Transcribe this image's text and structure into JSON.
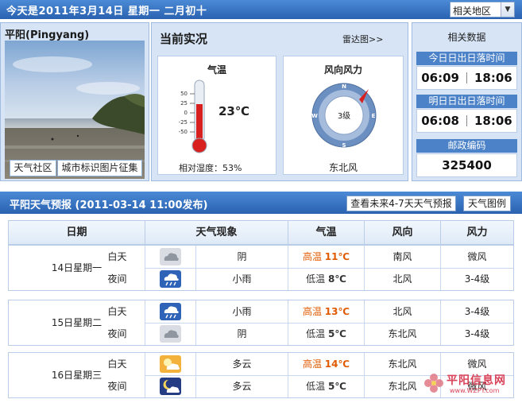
{
  "topbar": {
    "date": "今天是2011年3月14日 星期一 二月初十",
    "region": "相关地区"
  },
  "city": {
    "name": "平阳(Pingyang)",
    "btn_community": "天气社区",
    "btn_photo": "城市标识图片征集"
  },
  "current": {
    "title": "当前实况",
    "radar": "雷达图>>",
    "temp": {
      "title": "气温",
      "value": "23℃",
      "value_num": 23,
      "scale": [
        "50",
        "25",
        "0",
        "-25",
        "-50"
      ],
      "humidity": "相对湿度：53%"
    },
    "wind": {
      "title": "风向风力",
      "level": "3级",
      "dir": "东北风",
      "compass": [
        "N",
        "E",
        "S",
        "W"
      ]
    }
  },
  "data": {
    "title": "相关数据",
    "today_label": "今日日出日落时间",
    "today_rise": "06:09",
    "today_set": "18:06",
    "tomorrow_label": "明日日出日落时间",
    "tomorrow_rise": "06:08",
    "tomorrow_set": "18:06",
    "post_label": "邮政编码",
    "post_code": "325400"
  },
  "forecast": {
    "title": "平阳天气预报 (2011-03-14  11:00发布)",
    "btn_future": "查看未来4-7天天气预报",
    "btn_legend": "天气图例",
    "headers": [
      "日期",
      "天气现象",
      "气温",
      "风向",
      "风力"
    ],
    "days": [
      {
        "date": "14日星期一",
        "day": {
          "label": "白天",
          "weather": "阴",
          "icon": "overcast-icon",
          "tlabel": "高温",
          "temp": "11℃",
          "wind": "南风",
          "force": "微风"
        },
        "night": {
          "label": "夜间",
          "weather": "小雨",
          "icon": "rain-icon",
          "tlabel": "低温",
          "temp": "8℃",
          "wind": "北风",
          "force": "3-4级"
        }
      },
      {
        "date": "15日星期二",
        "day": {
          "label": "白天",
          "weather": "小雨",
          "icon": "rain-icon",
          "tlabel": "高温",
          "temp": "13℃",
          "wind": "北风",
          "force": "3-4级"
        },
        "night": {
          "label": "夜间",
          "weather": "阴",
          "icon": "overcast-icon",
          "tlabel": "低温",
          "temp": "5℃",
          "wind": "东北风",
          "force": "3-4级"
        }
      },
      {
        "date": "16日星期三",
        "day": {
          "label": "白天",
          "weather": "多云",
          "icon": "sun-cloud-icon",
          "tlabel": "高温",
          "temp": "14℃",
          "wind": "东北风",
          "force": "微风"
        },
        "night": {
          "label": "夜间",
          "weather": "多云",
          "icon": "moon-cloud-icon",
          "tlabel": "低温",
          "temp": "5℃",
          "wind": "东北风",
          "force": "微风"
        }
      }
    ]
  },
  "watermark": {
    "text": "平阳信息网",
    "url": "www.WZPY.com"
  }
}
